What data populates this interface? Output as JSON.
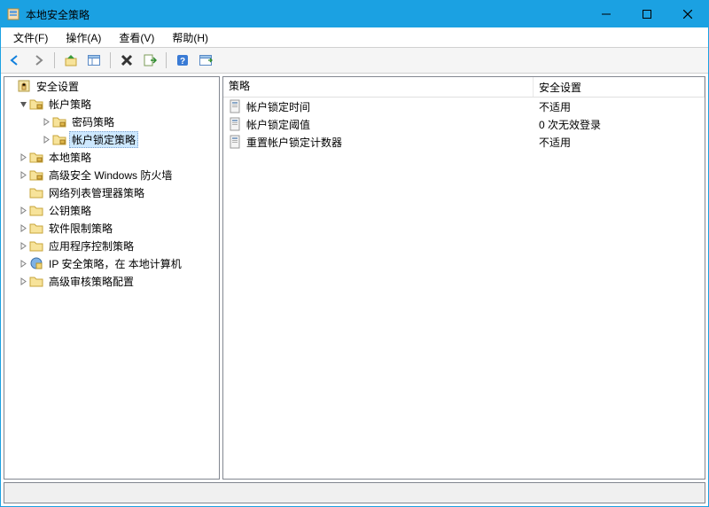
{
  "window": {
    "title": "本地安全策略"
  },
  "menu": {
    "file": "文件(F)",
    "action": "操作(A)",
    "view": "查看(V)",
    "help": "帮助(H)"
  },
  "tree": {
    "root": "安全设置",
    "account_policies": "帐户策略",
    "password_policy": "密码策略",
    "account_lockout_policy": "帐户锁定策略",
    "local_policies": "本地策略",
    "windows_firewall": "高级安全 Windows 防火墙",
    "network_list_mgr": "网络列表管理器策略",
    "public_key_policies": "公钥策略",
    "software_restriction": "软件限制策略",
    "app_control": "应用程序控制策略",
    "ip_security": "IP 安全策略，在 本地计算机",
    "advanced_audit": "高级审核策略配置"
  },
  "list": {
    "header_policy": "策略",
    "header_setting": "安全设置",
    "rows": [
      {
        "policy": "帐户锁定时间",
        "setting": "不适用"
      },
      {
        "policy": "帐户锁定阈值",
        "setting": "0 次无效登录"
      },
      {
        "policy": "重置帐户锁定计数器",
        "setting": "不适用"
      }
    ]
  }
}
